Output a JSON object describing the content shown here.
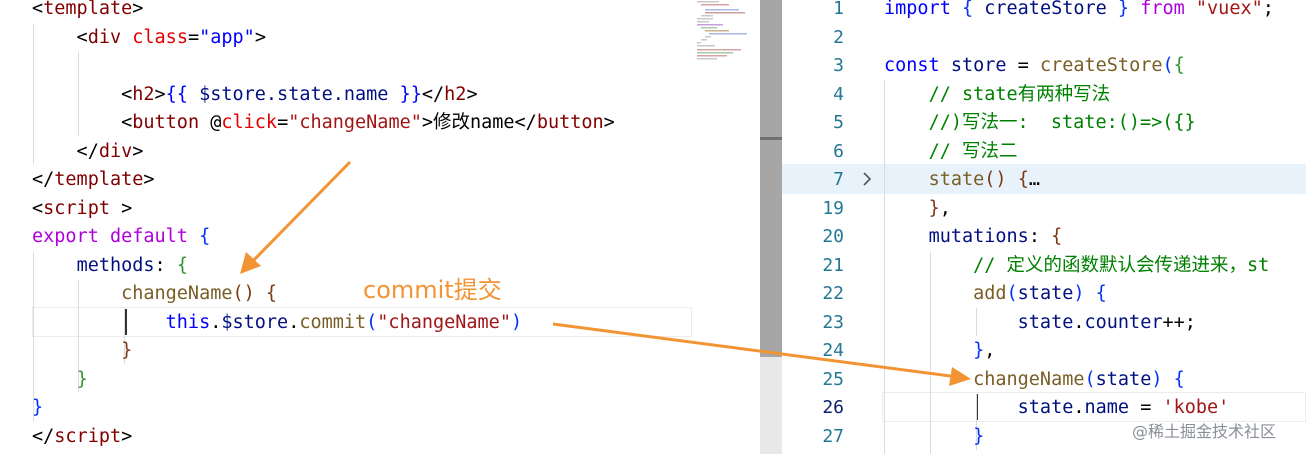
{
  "left_editor": {
    "lines": [
      [
        [
          "t-punc",
          "<"
        ],
        [
          "t-tag",
          "template"
        ],
        [
          "t-punc",
          ">"
        ]
      ],
      [
        [
          "t-punc",
          "    <"
        ],
        [
          "t-tag",
          "div"
        ],
        [
          "t-punc",
          " "
        ],
        [
          "t-attr",
          "class"
        ],
        [
          "t-punc",
          "="
        ],
        [
          "t-kw",
          "\"app\""
        ],
        [
          "t-punc",
          ">"
        ]
      ],
      [],
      [
        [
          "t-punc",
          "        <"
        ],
        [
          "t-tag",
          "h2"
        ],
        [
          "t-punc",
          ">"
        ],
        [
          "t-kw",
          "{{"
        ],
        [
          "t-punc",
          " "
        ],
        [
          "t-var",
          "$store.state.name"
        ],
        [
          "t-punc",
          " "
        ],
        [
          "t-kw",
          "}}"
        ],
        [
          "t-punc",
          "</"
        ],
        [
          "t-tag",
          "h2"
        ],
        [
          "t-punc",
          ">"
        ]
      ],
      [
        [
          "t-punc",
          "        <"
        ],
        [
          "t-tag",
          "button"
        ],
        [
          "t-punc",
          " @"
        ],
        [
          "t-attr",
          "click"
        ],
        [
          "t-punc",
          "="
        ],
        [
          "t-str",
          "\"changeName\""
        ],
        [
          "t-punc",
          ">修改name</"
        ],
        [
          "t-tag",
          "button"
        ],
        [
          "t-punc",
          ">"
        ]
      ],
      [
        [
          "t-punc",
          "    </"
        ],
        [
          "t-tag",
          "div"
        ],
        [
          "t-punc",
          ">"
        ]
      ],
      [
        [
          "t-punc",
          "</"
        ],
        [
          "t-tag",
          "template"
        ],
        [
          "t-punc",
          ">"
        ]
      ],
      [
        [
          "t-punc",
          "<"
        ],
        [
          "t-tag",
          "script"
        ],
        [
          "t-punc",
          " >"
        ]
      ],
      [
        [
          "t-ctrl",
          "export"
        ],
        [
          "t-punc",
          " "
        ],
        [
          "t-ctrl",
          "default"
        ],
        [
          "t-punc",
          " "
        ],
        [
          "t-brace1",
          "{"
        ]
      ],
      [
        [
          "t-punc",
          "    "
        ],
        [
          "t-var",
          "methods"
        ],
        [
          "t-punc",
          ": "
        ],
        [
          "t-brace2",
          "{"
        ]
      ],
      [
        [
          "t-punc",
          "        "
        ],
        [
          "t-fn",
          "changeName"
        ],
        [
          "t-brace3",
          "()"
        ],
        [
          "t-punc",
          " "
        ],
        [
          "t-brace3",
          "{"
        ]
      ],
      [
        [
          "t-punc",
          "            "
        ],
        [
          "t-kw",
          "this"
        ],
        [
          "t-punc",
          "."
        ],
        [
          "t-var",
          "$store"
        ],
        [
          "t-punc",
          "."
        ],
        [
          "t-fn",
          "commit"
        ],
        [
          "t-brace1",
          "("
        ],
        [
          "t-str",
          "\"changeName\""
        ],
        [
          "t-brace1",
          ")"
        ]
      ],
      [
        [
          "t-punc",
          "        "
        ],
        [
          "t-brace3",
          "}"
        ]
      ],
      [
        [
          "t-punc",
          "    "
        ],
        [
          "t-brace2",
          "}"
        ]
      ],
      [
        [
          "t-brace1",
          "}"
        ]
      ],
      [
        [
          "t-punc",
          "</"
        ],
        [
          "t-tag",
          "script"
        ],
        [
          "t-punc",
          ">"
        ]
      ]
    ]
  },
  "right_editor": {
    "line_numbers": [
      "1",
      "2",
      "3",
      "4",
      "5",
      "6",
      "7",
      "19",
      "20",
      "21",
      "22",
      "23",
      "24",
      "25",
      "26",
      "27"
    ],
    "active_line_number": "26",
    "lines": [
      [
        [
          "t-kw",
          "import"
        ],
        [
          "t-punc",
          " "
        ],
        [
          "t-brace1",
          "{"
        ],
        [
          "t-punc",
          " "
        ],
        [
          "t-var",
          "createStore"
        ],
        [
          "t-punc",
          " "
        ],
        [
          "t-brace1",
          "}"
        ],
        [
          "t-punc",
          " "
        ],
        [
          "t-ctrl",
          "from"
        ],
        [
          "t-punc",
          " "
        ],
        [
          "t-str",
          "\"vuex\""
        ],
        [
          "t-punc",
          ";"
        ]
      ],
      [],
      [
        [
          "t-kw",
          "const"
        ],
        [
          "t-punc",
          " "
        ],
        [
          "t-var",
          "store"
        ],
        [
          "t-punc",
          " = "
        ],
        [
          "t-fn",
          "createStore"
        ],
        [
          "t-brace1",
          "("
        ],
        [
          "t-brace2",
          "{"
        ]
      ],
      [
        [
          "t-punc",
          "    "
        ],
        [
          "t-cmt",
          "// state有两种写法"
        ]
      ],
      [
        [
          "t-punc",
          "    "
        ],
        [
          "t-cmt",
          "//)写法一:  state:()=>({}"
        ]
      ],
      [
        [
          "t-punc",
          "    "
        ],
        [
          "t-cmt",
          "// 写法二"
        ]
      ],
      [
        [
          "t-punc",
          "    "
        ],
        [
          "t-fn",
          "state"
        ],
        [
          "t-brace3",
          "()"
        ],
        [
          "t-punc",
          " "
        ],
        [
          "t-brace3",
          "{"
        ],
        [
          "t-punc",
          "…"
        ]
      ],
      [
        [
          "t-punc",
          "    "
        ],
        [
          "t-brace3",
          "}"
        ],
        [
          "t-punc",
          ","
        ]
      ],
      [
        [
          "t-punc",
          "    "
        ],
        [
          "t-var",
          "mutations"
        ],
        [
          "t-punc",
          ": "
        ],
        [
          "t-brace3",
          "{"
        ]
      ],
      [
        [
          "t-punc",
          "        "
        ],
        [
          "t-cmt",
          "// 定义的函数默认会传递进来，st"
        ]
      ],
      [
        [
          "t-punc",
          "        "
        ],
        [
          "t-fn",
          "add"
        ],
        [
          "t-brace1",
          "("
        ],
        [
          "t-var",
          "state"
        ],
        [
          "t-brace1",
          ")"
        ],
        [
          "t-punc",
          " "
        ],
        [
          "t-brace1",
          "{"
        ]
      ],
      [
        [
          "t-punc",
          "            "
        ],
        [
          "t-var",
          "state"
        ],
        [
          "t-punc",
          "."
        ],
        [
          "t-var",
          "counter"
        ],
        [
          "t-punc",
          "++;"
        ]
      ],
      [
        [
          "t-punc",
          "        "
        ],
        [
          "t-brace1",
          "}"
        ],
        [
          "t-punc",
          ","
        ]
      ],
      [
        [
          "t-punc",
          "        "
        ],
        [
          "t-fn",
          "changeName"
        ],
        [
          "t-brace1",
          "("
        ],
        [
          "t-var",
          "state"
        ],
        [
          "t-brace1",
          ")"
        ],
        [
          "t-punc",
          " "
        ],
        [
          "t-brace1",
          "{"
        ]
      ],
      [
        [
          "t-punc",
          "            "
        ],
        [
          "t-var",
          "state"
        ],
        [
          "t-punc",
          "."
        ],
        [
          "t-var",
          "name"
        ],
        [
          "t-punc",
          " = "
        ],
        [
          "t-str",
          "'kobe'"
        ]
      ],
      [
        [
          "t-punc",
          "        "
        ],
        [
          "t-brace1",
          "}"
        ]
      ]
    ]
  },
  "annotation": {
    "label": "commit提交",
    "color": "#f39434"
  },
  "watermark": "@稀土掘金技术社区",
  "icons": {
    "fold": "chevron-right-icon"
  }
}
